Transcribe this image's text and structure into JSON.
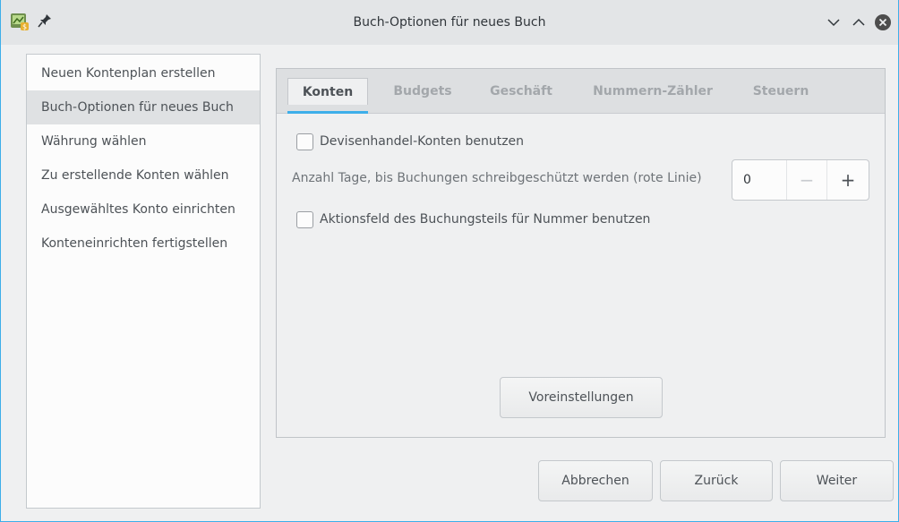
{
  "window": {
    "title": "Buch-Optionen für neues Buch"
  },
  "icons": {
    "app": "gnucash-app-icon",
    "pin": "pin-icon",
    "minimize": "chevron-down-icon",
    "maximize": "chevron-up-icon",
    "close": "close-icon"
  },
  "sidebar": {
    "items": [
      {
        "label": "Neuen Kontenplan erstellen"
      },
      {
        "label": "Buch-Optionen für neues Buch"
      },
      {
        "label": "Währung wählen"
      },
      {
        "label": "Zu erstellende Konten wählen"
      },
      {
        "label": "Ausgewähltes Konto einrichten"
      },
      {
        "label": "Konteneinrichten fertigstellen"
      }
    ],
    "active_index": 1
  },
  "tabs": [
    {
      "label": "Konten"
    },
    {
      "label": "Budgets"
    },
    {
      "label": "Geschäft"
    },
    {
      "label": "Nummern-Zähler"
    },
    {
      "label": "Steuern"
    }
  ],
  "konten": {
    "trading_accounts_label": "Devisenhandel-Konten benutzen",
    "trading_accounts_checked": false,
    "readonly_days_label": "Anzahl Tage, bis Buchungen schreibgeschützt werden (rote Linie)",
    "readonly_days_value": "0",
    "spin_minus": "−",
    "spin_plus": "+",
    "split_action_label": "Aktionsfeld des Buchungsteils für Nummer benutzen",
    "split_action_checked": false
  },
  "buttons": {
    "defaults": "Voreinstellungen",
    "cancel": "Abbrechen",
    "back": "Zurück",
    "next": "Weiter"
  },
  "colors": {
    "accent": "#3daee9",
    "window_bg": "#eff0f1",
    "sidebar_active": "#dfe1e3"
  }
}
